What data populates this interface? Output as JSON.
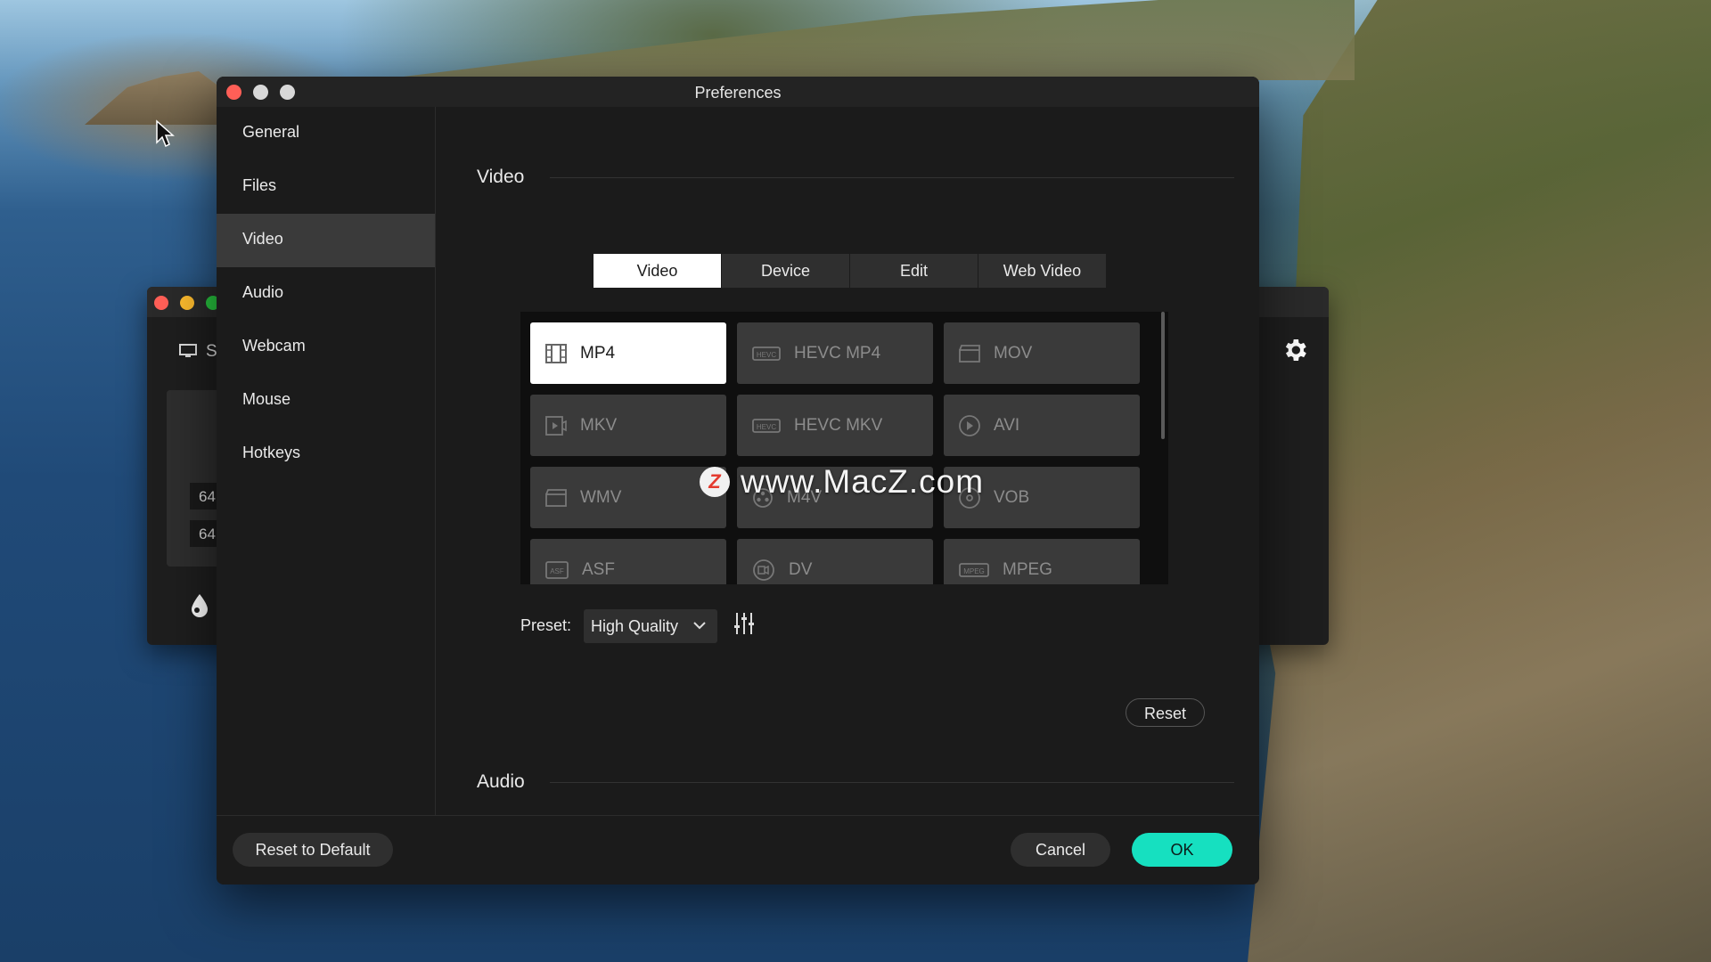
{
  "window": {
    "title": "Preferences"
  },
  "sidebar": {
    "items": [
      {
        "label": "General"
      },
      {
        "label": "Files"
      },
      {
        "label": "Video",
        "active": true
      },
      {
        "label": "Audio"
      },
      {
        "label": "Webcam"
      },
      {
        "label": "Mouse"
      },
      {
        "label": "Hotkeys"
      }
    ]
  },
  "sections": {
    "video": "Video",
    "audio": "Audio"
  },
  "tabs": [
    {
      "label": "Video",
      "active": true
    },
    {
      "label": "Device"
    },
    {
      "label": "Edit"
    },
    {
      "label": "Web Video"
    }
  ],
  "formats": [
    {
      "label": "MP4",
      "icon": "film-icon",
      "active": true
    },
    {
      "label": "HEVC MP4",
      "icon": "hevc-icon"
    },
    {
      "label": "MOV",
      "icon": "clapper-icon"
    },
    {
      "label": "MKV",
      "icon": "video-file-icon"
    },
    {
      "label": "HEVC MKV",
      "icon": "hevc-icon"
    },
    {
      "label": "AVI",
      "icon": "play-circle-icon"
    },
    {
      "label": "WMV",
      "icon": "clapper-icon"
    },
    {
      "label": "M4V",
      "icon": "reel-icon"
    },
    {
      "label": "VOB",
      "icon": "disc-icon"
    },
    {
      "label": "ASF",
      "icon": "asf-icon"
    },
    {
      "label": "DV",
      "icon": "dv-icon"
    },
    {
      "label": "MPEG",
      "icon": "mpeg-icon"
    }
  ],
  "preset": {
    "label": "Preset:",
    "value": "High Quality"
  },
  "buttons": {
    "reset": "Reset",
    "reset_default": "Reset to Default",
    "cancel": "Cancel",
    "ok": "OK"
  },
  "watermark": {
    "badge": "Z",
    "text": "www.MacZ.com"
  },
  "background_window": {
    "label": "S",
    "values": [
      "64",
      "64"
    ]
  },
  "colors": {
    "accent": "#16e0c0",
    "close": "#ff5f57",
    "minimize": "#febc2e"
  }
}
